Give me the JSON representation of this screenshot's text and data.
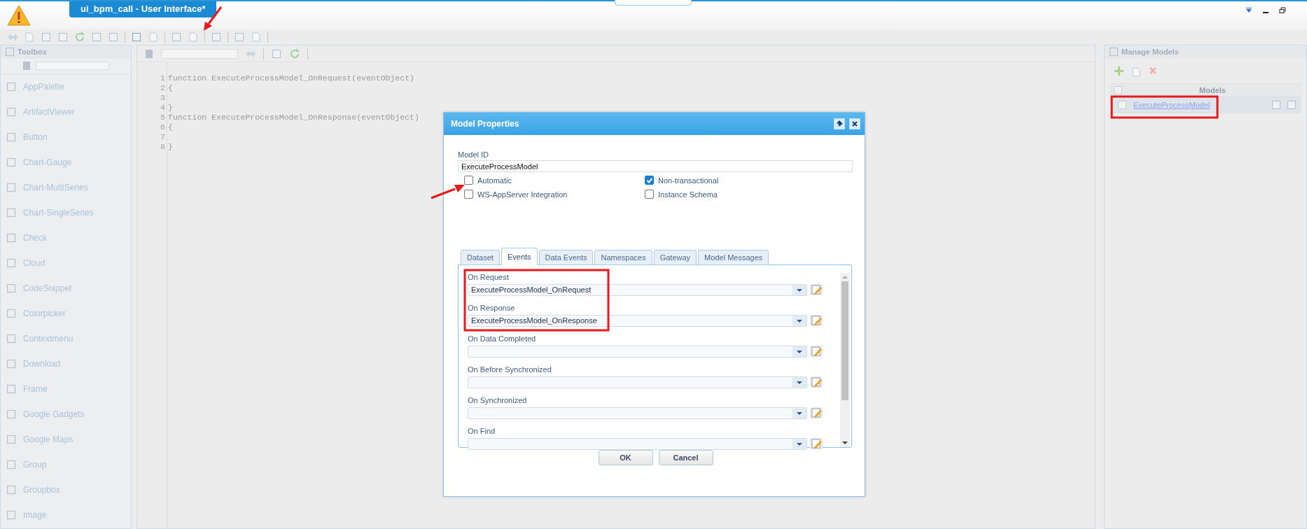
{
  "window": {
    "title": "ui_bpm_call - User Interface*"
  },
  "toolbox": {
    "title": "Toolbox",
    "items": [
      {
        "label": "AppPalette"
      },
      {
        "label": "ArtifactViewer"
      },
      {
        "label": "Button"
      },
      {
        "label": "Chart-Gauge"
      },
      {
        "label": "Chart-MultiSeries"
      },
      {
        "label": "Chart-SingleSeries"
      },
      {
        "label": "Check"
      },
      {
        "label": "Cloud"
      },
      {
        "label": "CodeSnippet"
      },
      {
        "label": "Colorpicker"
      },
      {
        "label": "Contextmenu"
      },
      {
        "label": "Download"
      },
      {
        "label": "Frame"
      },
      {
        "label": "Google Gadgets"
      },
      {
        "label": "Google Maps"
      },
      {
        "label": "Group"
      },
      {
        "label": "Groupbox"
      },
      {
        "label": "Image"
      }
    ]
  },
  "editor": {
    "lines": [
      {
        "number": "1",
        "code": "function ExecuteProcessModel_OnRequest(eventObject)"
      },
      {
        "number": "2",
        "code": "{"
      },
      {
        "number": "3"
      },
      {
        "number": "4",
        "code": "}"
      },
      {
        "number": "5",
        "code": "function ExecuteProcessModel_OnResponse(eventObject)"
      },
      {
        "number": "6",
        "code": "{"
      },
      {
        "number": "7"
      },
      {
        "number": "8",
        "code": "}"
      }
    ]
  },
  "manage_models": {
    "title": "Manage Models",
    "column": "Models",
    "all_checked": false,
    "rows": [
      {
        "name": "ExecuteProcessModel",
        "checked": false
      }
    ]
  },
  "dialog": {
    "title": "Model Properties",
    "model_id_label": "Model ID",
    "model_id": "ExecuteProcessModel",
    "options": [
      {
        "label": "Automatic",
        "checked": false
      },
      {
        "label": "Non-transactional",
        "checked": true
      },
      {
        "label": "WS-AppServer Integration",
        "checked": false
      },
      {
        "label": "Instance Schema",
        "checked": false
      }
    ],
    "tabs": [
      {
        "label": "Dataset",
        "selected": false
      },
      {
        "label": "Events",
        "selected": true
      },
      {
        "label": "Data Events",
        "selected": false
      },
      {
        "label": "Namespaces",
        "selected": false
      },
      {
        "label": "Gateway",
        "selected": false
      },
      {
        "label": "Model Messages",
        "selected": false
      }
    ],
    "events": [
      {
        "label": "On Request",
        "value": "ExecuteProcessModel_OnRequest"
      },
      {
        "label": "On Response",
        "value": "ExecuteProcessModel_OnResponse"
      },
      {
        "label": "On Data Completed"
      },
      {
        "label": "On Before Synchronized"
      },
      {
        "label": "On Synchronized"
      },
      {
        "label": "On Find"
      }
    ],
    "buttons": [
      "OK",
      "Cancel"
    ]
  }
}
